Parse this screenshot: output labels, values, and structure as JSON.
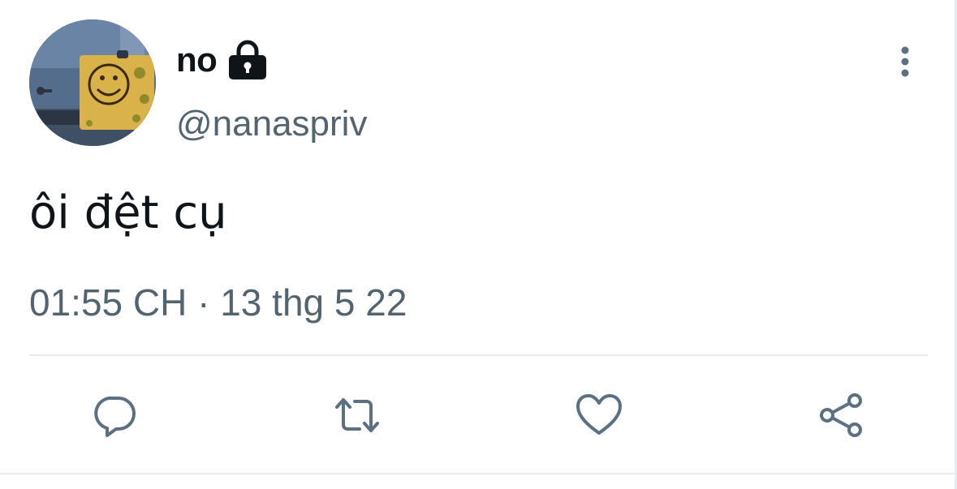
{
  "tweet": {
    "display_name": "no",
    "handle": "@nanaspriv",
    "text": "ôi đệt cụ",
    "timestamp": "01:55 CH · 13 thg 5 22",
    "protected_icon": "lock-icon",
    "avatar_icon": "spongebob-avatar"
  },
  "actions": [
    {
      "icon": "reply-icon"
    },
    {
      "icon": "retweet-icon"
    },
    {
      "icon": "like-icon"
    },
    {
      "icon": "share-icon"
    }
  ],
  "colors": {
    "text_primary": "#0f1419",
    "text_secondary": "#536471",
    "icon": "#5b7083",
    "divider": "#e6ebee"
  }
}
